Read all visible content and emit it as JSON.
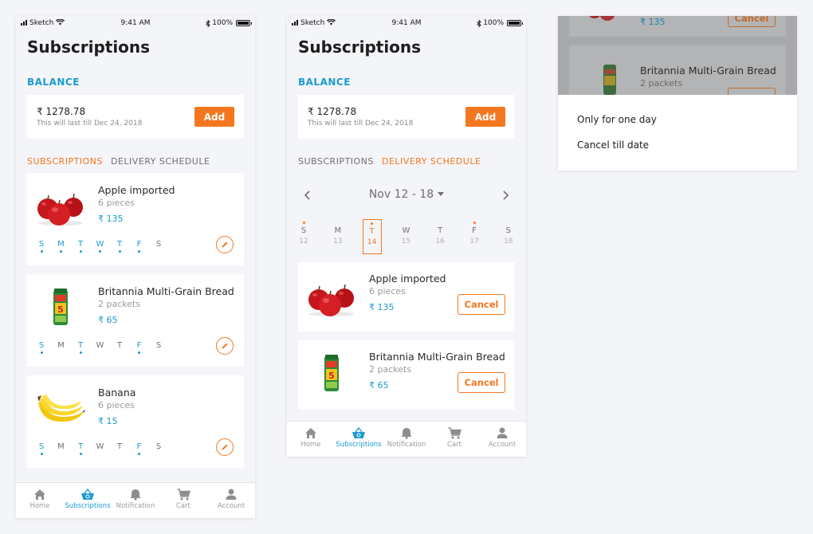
{
  "status": {
    "carrier": "Sketch",
    "time": "9:41 AM",
    "battery": "100%"
  },
  "screen1": {
    "title": "Subscriptions",
    "balance_label": "BALANCE",
    "balance_amount": "₹ 1278.78",
    "balance_note": "This will last till Dec 24, 2018",
    "add_label": "Add",
    "tabs": [
      "SUBSCRIPTIONS",
      "DELIVERY SCHEDULE"
    ],
    "active_tab": 0,
    "items": [
      {
        "name": "Apple imported",
        "qty": "6 pieces",
        "price": "₹ 135",
        "icon": "apples-image",
        "active_days": [
          0,
          1,
          2,
          3,
          4,
          5
        ]
      },
      {
        "name": "Britannia Multi-Grain Bread",
        "qty": "2 packets",
        "price": "₹ 65",
        "icon": "bread-image",
        "active_days": [
          0,
          2,
          5
        ]
      },
      {
        "name": "Banana",
        "qty": "6 pieces",
        "price": "₹ 15",
        "icon": "banana-image",
        "active_days": [
          0,
          2,
          5
        ]
      }
    ],
    "weekday_letters": [
      "S",
      "M",
      "T",
      "W",
      "T",
      "F",
      "S"
    ]
  },
  "screen2": {
    "title": "Subscriptions",
    "balance_label": "BALANCE",
    "balance_amount": "₹ 1278.78",
    "balance_note": "This will last till Dec 24, 2018",
    "add_label": "Add",
    "tabs": [
      "SUBSCRIPTIONS",
      "DELIVERY SCHEDULE"
    ],
    "active_tab": 1,
    "week_range": "Nov 12 - 18",
    "calendar": [
      {
        "letter": "S",
        "date": "12",
        "marked": true
      },
      {
        "letter": "M",
        "date": "13",
        "marked": false
      },
      {
        "letter": "T",
        "date": "14",
        "marked": true,
        "selected": true
      },
      {
        "letter": "W",
        "date": "15",
        "marked": false
      },
      {
        "letter": "T",
        "date": "16",
        "marked": false
      },
      {
        "letter": "F",
        "date": "17",
        "marked": true
      },
      {
        "letter": "S",
        "date": "18",
        "marked": false
      }
    ],
    "deliveries": [
      {
        "name": "Apple imported",
        "qty": "6 pieces",
        "price": "₹ 135",
        "icon": "apples-image",
        "cancel_label": "Cancel"
      },
      {
        "name": "Britannia Multi-Grain Bread",
        "qty": "2 packets",
        "price": "₹ 65",
        "icon": "bread-image",
        "cancel_label": "Cancel"
      }
    ]
  },
  "screen3": {
    "bg_partial_price": "₹ 135",
    "bg_cancel_label": "Cancel",
    "bg_item_name": "Britannia Multi-Grain Bread",
    "bg_item_qty": "2 packets",
    "options": [
      "Only for one day",
      "Cancel till date"
    ]
  },
  "nav": [
    {
      "label": "Home",
      "icon": "home-icon"
    },
    {
      "label": "Subscriptions",
      "icon": "basket-icon"
    },
    {
      "label": "Notification",
      "icon": "bell-icon"
    },
    {
      "label": "Cart",
      "icon": "cart-icon"
    },
    {
      "label": "Account",
      "icon": "account-icon"
    }
  ],
  "nav_active": 1,
  "colors": {
    "accent_orange": "#f47720",
    "accent_blue": "#1b9bd1",
    "background": "#f4f5f8"
  }
}
